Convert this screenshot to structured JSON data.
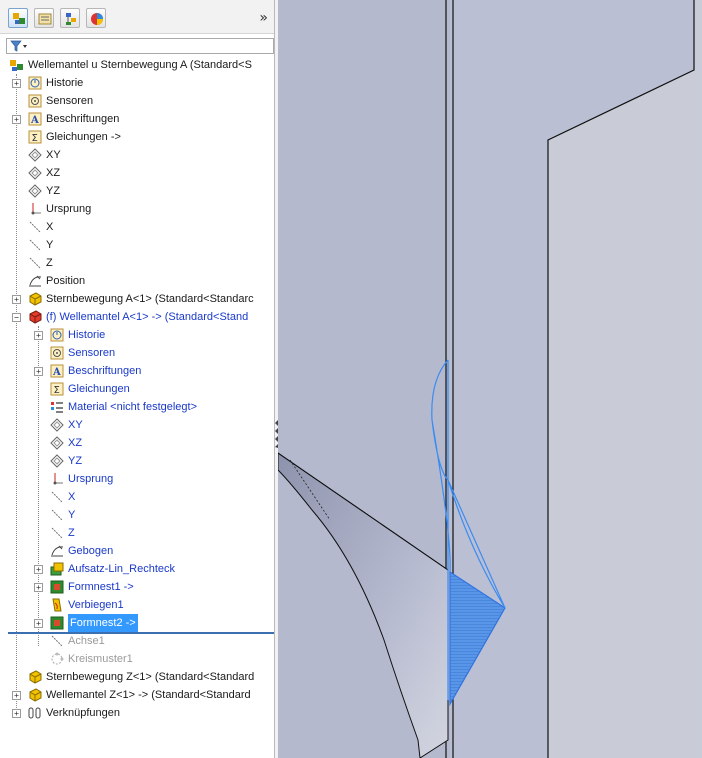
{
  "panel": {
    "tabs": [
      {
        "name": "featuremanager-tab-icon",
        "active": true
      },
      {
        "name": "propertymanager-tab-icon",
        "active": false
      },
      {
        "name": "configurationmanager-tab-icon",
        "active": false
      },
      {
        "name": "displaymanager-tab-icon",
        "active": false
      }
    ],
    "expand_label": "»",
    "filter_icon": "filter-icon"
  },
  "tree": {
    "root": "Wellemantel u Sternbewegung A  (Standard<S",
    "items": [
      {
        "label": "Historie",
        "icon": "history-icon"
      },
      {
        "label": "Sensoren",
        "icon": "sensor-icon"
      },
      {
        "label": "Beschriftungen",
        "icon": "annotation-icon"
      },
      {
        "label": "Gleichungen ->",
        "icon": "equation-icon"
      },
      {
        "label": "XY",
        "icon": "plane-icon"
      },
      {
        "label": "XZ",
        "icon": "plane-icon"
      },
      {
        "label": "YZ",
        "icon": "plane-icon"
      },
      {
        "label": "Ursprung",
        "icon": "origin-icon"
      },
      {
        "label": "X",
        "icon": "axis-icon"
      },
      {
        "label": "Y",
        "icon": "axis-icon"
      },
      {
        "label": "Z",
        "icon": "axis-icon"
      },
      {
        "label": "Position",
        "icon": "sketch-icon"
      },
      {
        "label": "Sternbewegung A<1> (Standard<Standarc",
        "icon": "part-icon"
      },
      {
        "label": "(f) Wellemantel A<1> -> (Standard<Stand",
        "icon": "part-edit-icon"
      },
      {
        "label": "Historie",
        "icon": "history-icon"
      },
      {
        "label": "Sensoren",
        "icon": "sensor-icon"
      },
      {
        "label": "Beschriftungen",
        "icon": "annotation-icon"
      },
      {
        "label": "Gleichungen",
        "icon": "equation-icon"
      },
      {
        "label": "Material <nicht festgelegt>",
        "icon": "material-icon"
      },
      {
        "label": "XY",
        "icon": "plane-icon"
      },
      {
        "label": "XZ",
        "icon": "plane-icon"
      },
      {
        "label": "YZ",
        "icon": "plane-icon"
      },
      {
        "label": "Ursprung",
        "icon": "origin-icon"
      },
      {
        "label": "X",
        "icon": "axis-icon"
      },
      {
        "label": "Y",
        "icon": "axis-icon"
      },
      {
        "label": "Z",
        "icon": "axis-icon"
      },
      {
        "label": "Gebogen",
        "icon": "sketch-icon"
      },
      {
        "label": "Aufsatz-Lin_Rechteck",
        "icon": "boss-extrude-icon"
      },
      {
        "label": "Formnest1 ->",
        "icon": "cavity-icon"
      },
      {
        "label": "Verbiegen1",
        "icon": "flex-icon"
      },
      {
        "label": "Formnest2 ->",
        "icon": "cavity-icon"
      },
      {
        "label": "Achse1",
        "icon": "axis-icon"
      },
      {
        "label": "Kreismuster1",
        "icon": "circular-pattern-icon"
      },
      {
        "label": "Sternbewegung Z<1> (Standard<Standard",
        "icon": "part-icon"
      },
      {
        "label": "Wellemantel Z<1> -> (Standard<Standard",
        "icon": "part-icon"
      },
      {
        "label": "Verknüpfungen",
        "icon": "mates-icon"
      }
    ]
  },
  "colors": {
    "edit_blue": "#1a39c9",
    "selection": "#3399ff",
    "suppressed_grey": "#9a9a9a",
    "viewport_light": "#c9ccd6",
    "viewport_mid": "#b7bcd0",
    "viewport_dark": "#a4aac2",
    "highlight": "#3b8cf0"
  }
}
